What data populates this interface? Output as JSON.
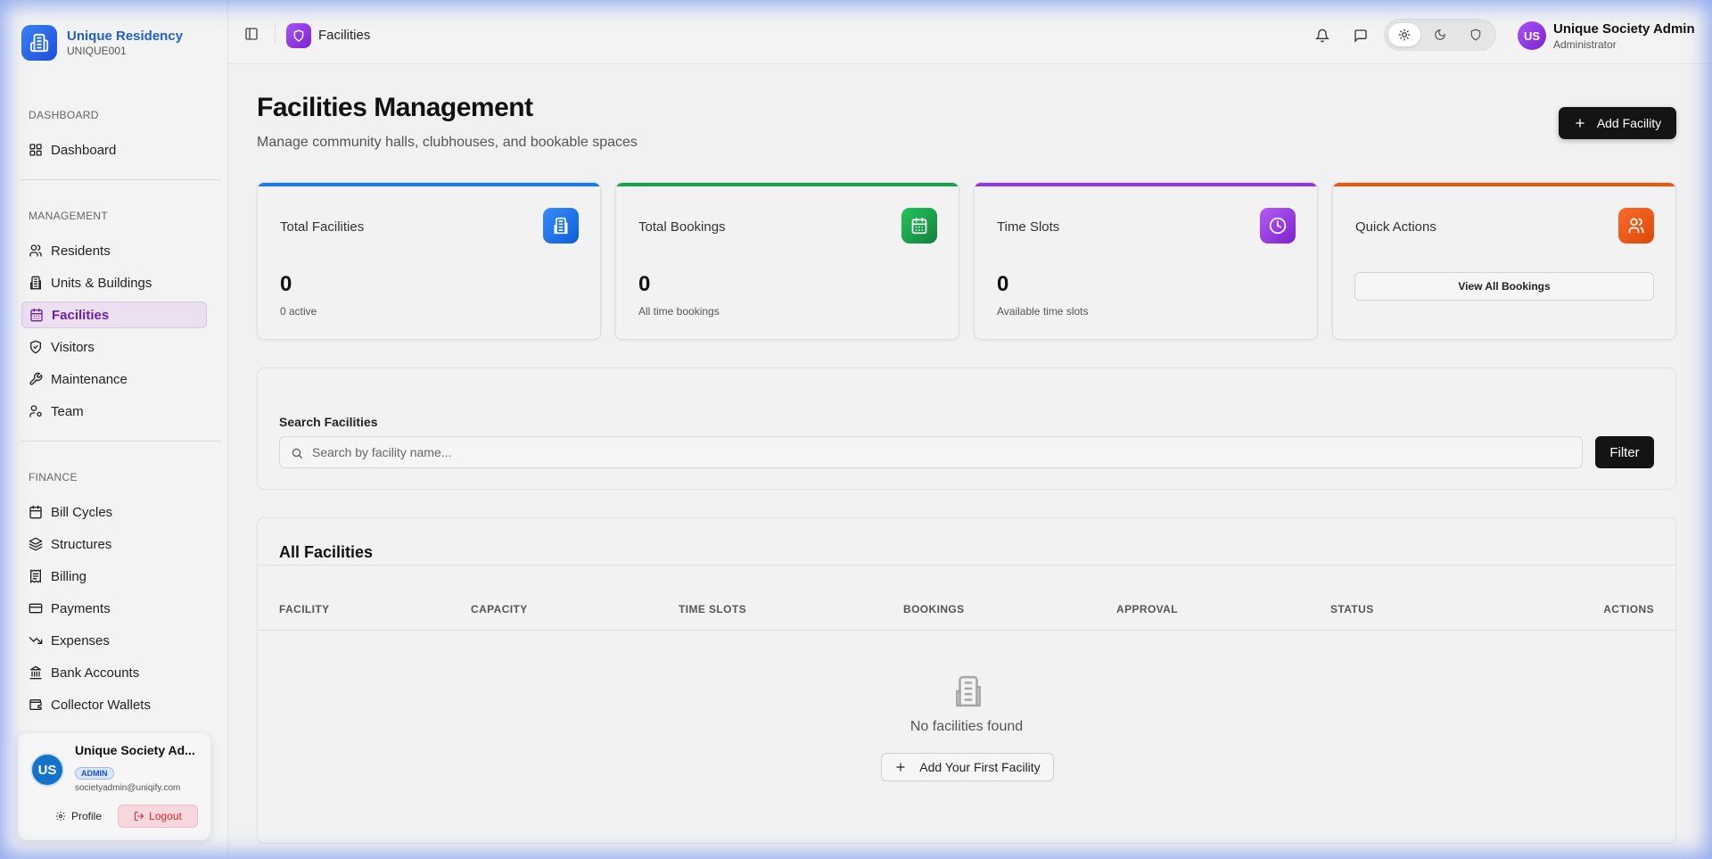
{
  "brand": {
    "name": "Unique Residency",
    "code": "UNIQUE001"
  },
  "sidebar": {
    "sections": [
      {
        "heading": "DASHBOARD",
        "items": [
          {
            "label": "Dashboard",
            "icon": "grid-icon"
          }
        ]
      },
      {
        "heading": "MANAGEMENT",
        "items": [
          {
            "label": "Residents",
            "icon": "users-icon"
          },
          {
            "label": "Units & Buildings",
            "icon": "building-icon"
          },
          {
            "label": "Facilities",
            "icon": "calendar-icon",
            "active": true
          },
          {
            "label": "Visitors",
            "icon": "shield-icon"
          },
          {
            "label": "Maintenance",
            "icon": "wrench-icon"
          },
          {
            "label": "Team",
            "icon": "user-cog-icon"
          }
        ]
      },
      {
        "heading": "FINANCE",
        "items": [
          {
            "label": "Bill Cycles",
            "icon": "calendar-icon"
          },
          {
            "label": "Structures",
            "icon": "layers-icon"
          },
          {
            "label": "Billing",
            "icon": "receipt-icon"
          },
          {
            "label": "Payments",
            "icon": "credit-card-icon"
          },
          {
            "label": "Expenses",
            "icon": "trend-down-icon"
          },
          {
            "label": "Bank Accounts",
            "icon": "bank-icon"
          },
          {
            "label": "Collector Wallets",
            "icon": "wallet-icon"
          }
        ]
      }
    ],
    "user": {
      "initials": "US",
      "name": "Unique Society Ad...",
      "badge": "ADMIN",
      "email": "societyadmin@uniqify.com",
      "profile_label": "Profile",
      "logout_label": "Logout"
    }
  },
  "topbar": {
    "page_title": "Facilities",
    "user": {
      "initials": "US",
      "name": "Unique Society Admin",
      "role": "Administrator"
    }
  },
  "header": {
    "title": "Facilities Management",
    "subtitle": "Manage community halls, clubhouses, and bookable spaces",
    "add_label": "Add Facility"
  },
  "stats": [
    {
      "label": "Total Facilities",
      "value": "0",
      "note": "0 active",
      "color": "#1677ff",
      "icon": "building-icon"
    },
    {
      "label": "Total Bookings",
      "value": "0",
      "note": "All time bookings",
      "color": "#16a34a",
      "icon": "calendar-icon"
    },
    {
      "label": "Time Slots",
      "value": "0",
      "note": "Available time slots",
      "color": "#9333ea",
      "icon": "clock-icon"
    },
    {
      "label": "Quick Actions",
      "button": "View All Bookings",
      "color": "#ea580c",
      "icon": "users-icon"
    }
  ],
  "search": {
    "label": "Search Facilities",
    "placeholder": "Search by facility name...",
    "value": "",
    "filter_label": "Filter"
  },
  "table": {
    "title": "All Facilities",
    "columns": [
      "FACILITY",
      "CAPACITY",
      "TIME SLOTS",
      "BOOKINGS",
      "APPROVAL",
      "STATUS",
      "ACTIONS"
    ],
    "rows": [],
    "empty_text": "No facilities found",
    "empty_button": "Add Your First Facility"
  }
}
